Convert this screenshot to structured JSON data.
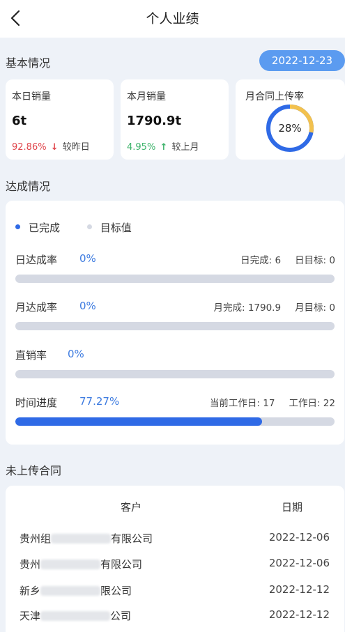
{
  "header": {
    "title": "个人业绩",
    "back_icon": "chevron-left-icon"
  },
  "basic": {
    "title": "基本情况",
    "date": "2022-12-23",
    "daily": {
      "label": "本日销量",
      "value": "6t",
      "change": "92.86%",
      "direction": "down",
      "compare": "较昨日"
    },
    "monthly": {
      "label": "本月销量",
      "value": "1790.9t",
      "change": "4.95%",
      "direction": "up",
      "compare": "较上月"
    },
    "contract": {
      "label": "月合同上传率",
      "value": "28%",
      "fraction": 0.28
    }
  },
  "achieve": {
    "title": "达成情况",
    "legend": {
      "done": "已完成",
      "target": "目标值"
    },
    "colors": {
      "done": "#2f6ae6",
      "target": "#d5d9e3"
    },
    "rows": [
      {
        "label": "日达成率",
        "pct": "0%",
        "fraction": 0,
        "right1": "日完成: 6",
        "right2": "日目标: 0"
      },
      {
        "label": "月达成率",
        "pct": "0%",
        "fraction": 0,
        "right1": "月完成: 1790.9",
        "right2": "月目标: 0"
      },
      {
        "label": "直销率",
        "pct": "0%",
        "fraction": 0,
        "right1": "",
        "right2": ""
      },
      {
        "label": "时间进度",
        "pct": "77.27%",
        "fraction": 0.7727,
        "right1": "当前工作日: 17",
        "right2": "工作日: 22"
      }
    ]
  },
  "contracts": {
    "title": "未上传合同",
    "headers": {
      "customer": "客户",
      "date": "日期"
    },
    "rows": [
      {
        "prefix": "贵州组",
        "suffix": "有限公司",
        "date": "2022-12-06"
      },
      {
        "prefix": "贵州",
        "suffix": "有限公司",
        "date": "2022-12-06"
      },
      {
        "prefix": "新乡",
        "suffix": "限公司",
        "date": "2022-12-12"
      },
      {
        "prefix": "天津",
        "suffix": "公司",
        "date": "2022-12-12"
      }
    ]
  }
}
